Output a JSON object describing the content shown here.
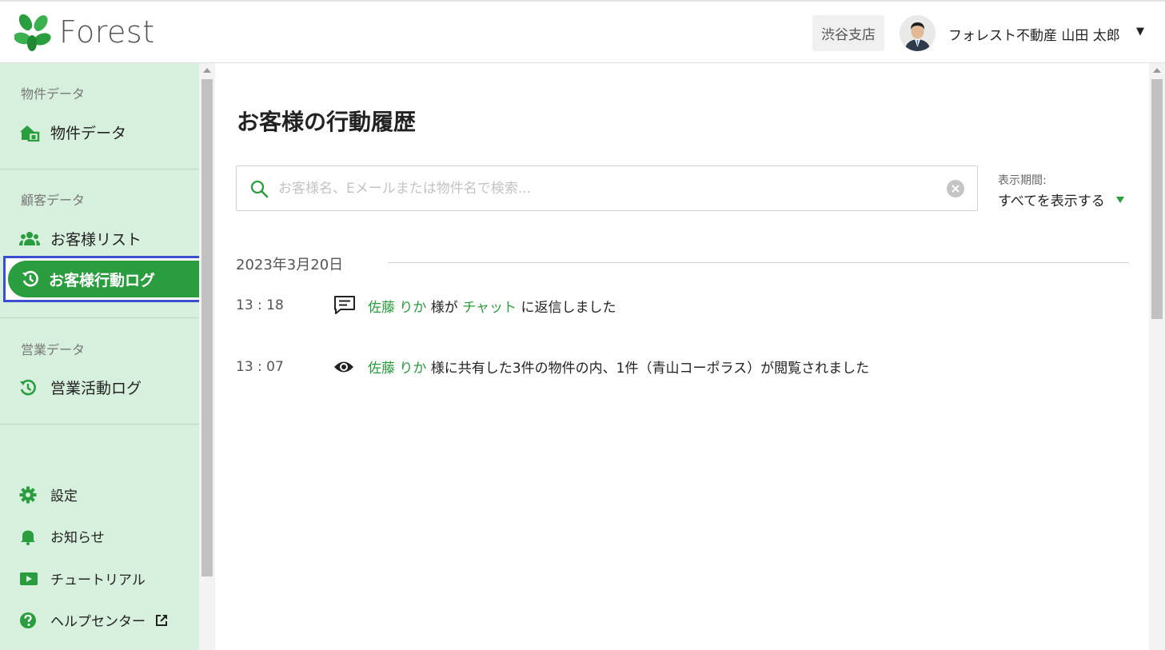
{
  "header": {
    "logo_text": "Forest",
    "branch": "渋谷支店",
    "user_name": "フォレスト不動産 山田 太郎",
    "user_caret": "▼"
  },
  "sidebar": {
    "sections": [
      {
        "label": "物件データ",
        "items": [
          {
            "label": "物件データ",
            "icon": "house-icon"
          }
        ]
      },
      {
        "label": "顧客データ",
        "items": [
          {
            "label": "お客様リスト",
            "icon": "users-icon"
          },
          {
            "label": "お客様行動ログ",
            "icon": "history-icon",
            "active": true
          }
        ]
      },
      {
        "label": "営業データ",
        "items": [
          {
            "label": "営業活動ログ",
            "icon": "history-icon"
          }
        ]
      }
    ],
    "bottom": [
      {
        "label": "設定",
        "icon": "gear-icon"
      },
      {
        "label": "お知らせ",
        "icon": "bell-icon"
      },
      {
        "label": "チュートリアル",
        "icon": "video-icon"
      },
      {
        "label": "ヘルプセンター",
        "icon": "help-icon"
      }
    ]
  },
  "main": {
    "title": "お客様の行動履歴",
    "search_placeholder": "お客様名、Eメールまたは物件名で検索...",
    "period_label": "表示期間:",
    "period_value": "すべてを表示する",
    "date": "2023年3月20日",
    "logs": [
      {
        "time": "13 : 18",
        "icon": "chat-icon",
        "customer": "佐藤 りか",
        "t1": " 様が ",
        "link": "チャット",
        "t2": " に返信しました"
      },
      {
        "time": "13 : 07",
        "icon": "eye-icon",
        "customer": "佐藤 りか",
        "t1": " 様に共有した3件の物件の内、1件（青山コーポラス）が閲覧されました"
      }
    ]
  },
  "colors": {
    "accent": "#2a9d3e",
    "sidebar_bg": "#d7f0dd",
    "focus_outline": "#3a4fd0"
  }
}
